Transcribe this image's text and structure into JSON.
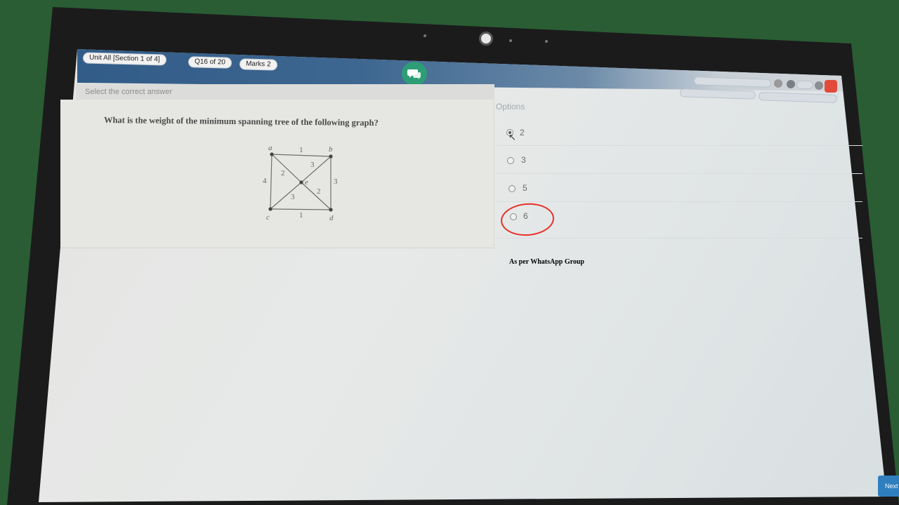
{
  "header": {
    "section_label": "Unit All [Section 1 of 4]",
    "question_counter": "Q16 of 20",
    "marks": "Marks 2",
    "chat_icon": "chat-bubbles-icon"
  },
  "subheader": {
    "instruction": "Select the correct answer"
  },
  "question": {
    "text": "What is the weight of the minimum spanning tree of the following graph?",
    "graph": {
      "nodes": [
        "a",
        "b",
        "c",
        "d",
        "e"
      ],
      "edges": [
        {
          "from": "a",
          "to": "b",
          "weight": "1"
        },
        {
          "from": "a",
          "to": "c",
          "weight": "4"
        },
        {
          "from": "b",
          "to": "d",
          "weight": "3"
        },
        {
          "from": "c",
          "to": "d",
          "weight": "1"
        },
        {
          "from": "a",
          "to": "e",
          "weight": "2"
        },
        {
          "from": "b",
          "to": "e",
          "weight": "3"
        },
        {
          "from": "c",
          "to": "e",
          "weight": "3"
        },
        {
          "from": "d",
          "to": "e",
          "weight": "2"
        }
      ]
    }
  },
  "options": {
    "label": "Options",
    "items": [
      {
        "label": "2",
        "selected": true
      },
      {
        "label": "3",
        "selected": false
      },
      {
        "label": "5",
        "selected": false
      },
      {
        "label": "6",
        "selected": false,
        "circled": true
      }
    ]
  },
  "annotation": {
    "text": "As per WhatsApp Group",
    "circle_color": "#e8302a"
  },
  "footer": {
    "next_label": "Next"
  },
  "colors": {
    "header_blue": "#2f5a86",
    "chat_green": "#2e9d76",
    "close_red": "#e24a3a",
    "next_blue": "#2f7fbf"
  }
}
